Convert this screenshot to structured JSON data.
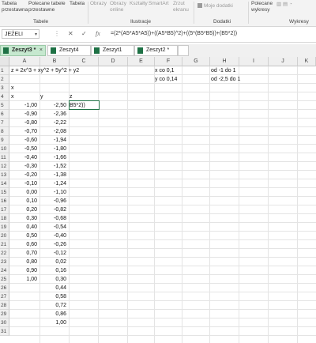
{
  "ribbon": {
    "buttons": [
      "Tabela\nprzestawna",
      "Polecane tabele\nprzestawne",
      "Tabela",
      "Obrazy",
      "Obrazy\nonline",
      "Kształty",
      "SmartArt",
      "Zrzut\nekranu",
      "Moje dodatki",
      "Polecane\nwykresy"
    ],
    "groups": [
      "Tabele",
      "Ilustracje",
      "Dodatki",
      "Wykresy"
    ]
  },
  "formula_bar": {
    "name_box": "JEŻELI",
    "cancel": "✕",
    "enter": "✓",
    "fx": "fx",
    "formula": "=(2*(A5*A5*A5))+((A5*B5)^2)+((5*(B5*B5))+(B5*2))"
  },
  "tabs": [
    {
      "label": "Zeszyt3 *",
      "active": true
    },
    {
      "label": "Zeszyt4",
      "active": false
    },
    {
      "label": "Zeszyt1",
      "active": false
    },
    {
      "label": "Zeszyt2 *",
      "active": false
    }
  ],
  "columns": [
    "A",
    "B",
    "C",
    "D",
    "E",
    "F",
    "G",
    "H",
    "I",
    "J",
    "K"
  ],
  "rows": [
    "1",
    "2",
    "3",
    "4",
    "5",
    "6",
    "7",
    "8",
    "9",
    "10",
    "11",
    "12",
    "13",
    "14",
    "15",
    "16",
    "17",
    "18",
    "19",
    "20",
    "21",
    "22",
    "23",
    "24",
    "25",
    "26",
    "27",
    "28",
    "29",
    "30",
    "31"
  ],
  "cells": {
    "a1": "z = 2x^3 + xy^2 + 5y^2 + y2",
    "f1": "x co 0,1",
    "h1": "od -1 do 1",
    "f2": "y co 0,14",
    "h2": "od -2,5 do 1",
    "a3": "x",
    "a4": "x",
    "b4": "y",
    "c4": "z",
    "c5": "B5*2))",
    "col_a": [
      "-1,00",
      "-0,90",
      "-0,80",
      "-0,70",
      "-0,60",
      "-0,50",
      "-0,40",
      "-0,30",
      "-0,20",
      "-0,10",
      "0,00",
      "0,10",
      "0,20",
      "0,30",
      "0,40",
      "0,50",
      "0,60",
      "0,70",
      "0,80",
      "0,90",
      "1,00"
    ],
    "col_b": [
      "-2,50",
      "-2,36",
      "-2,22",
      "-2,08",
      "-1,94",
      "-1,80",
      "-1,66",
      "-1,52",
      "-1,38",
      "-1,24",
      "-1,10",
      "-0,96",
      "-0,82",
      "-0,68",
      "-0,54",
      "-0,40",
      "-0,26",
      "-0,12",
      "0,02",
      "0,16",
      "0,30",
      "0,44",
      "0,58",
      "0,72",
      "0,86",
      "1,00"
    ]
  }
}
